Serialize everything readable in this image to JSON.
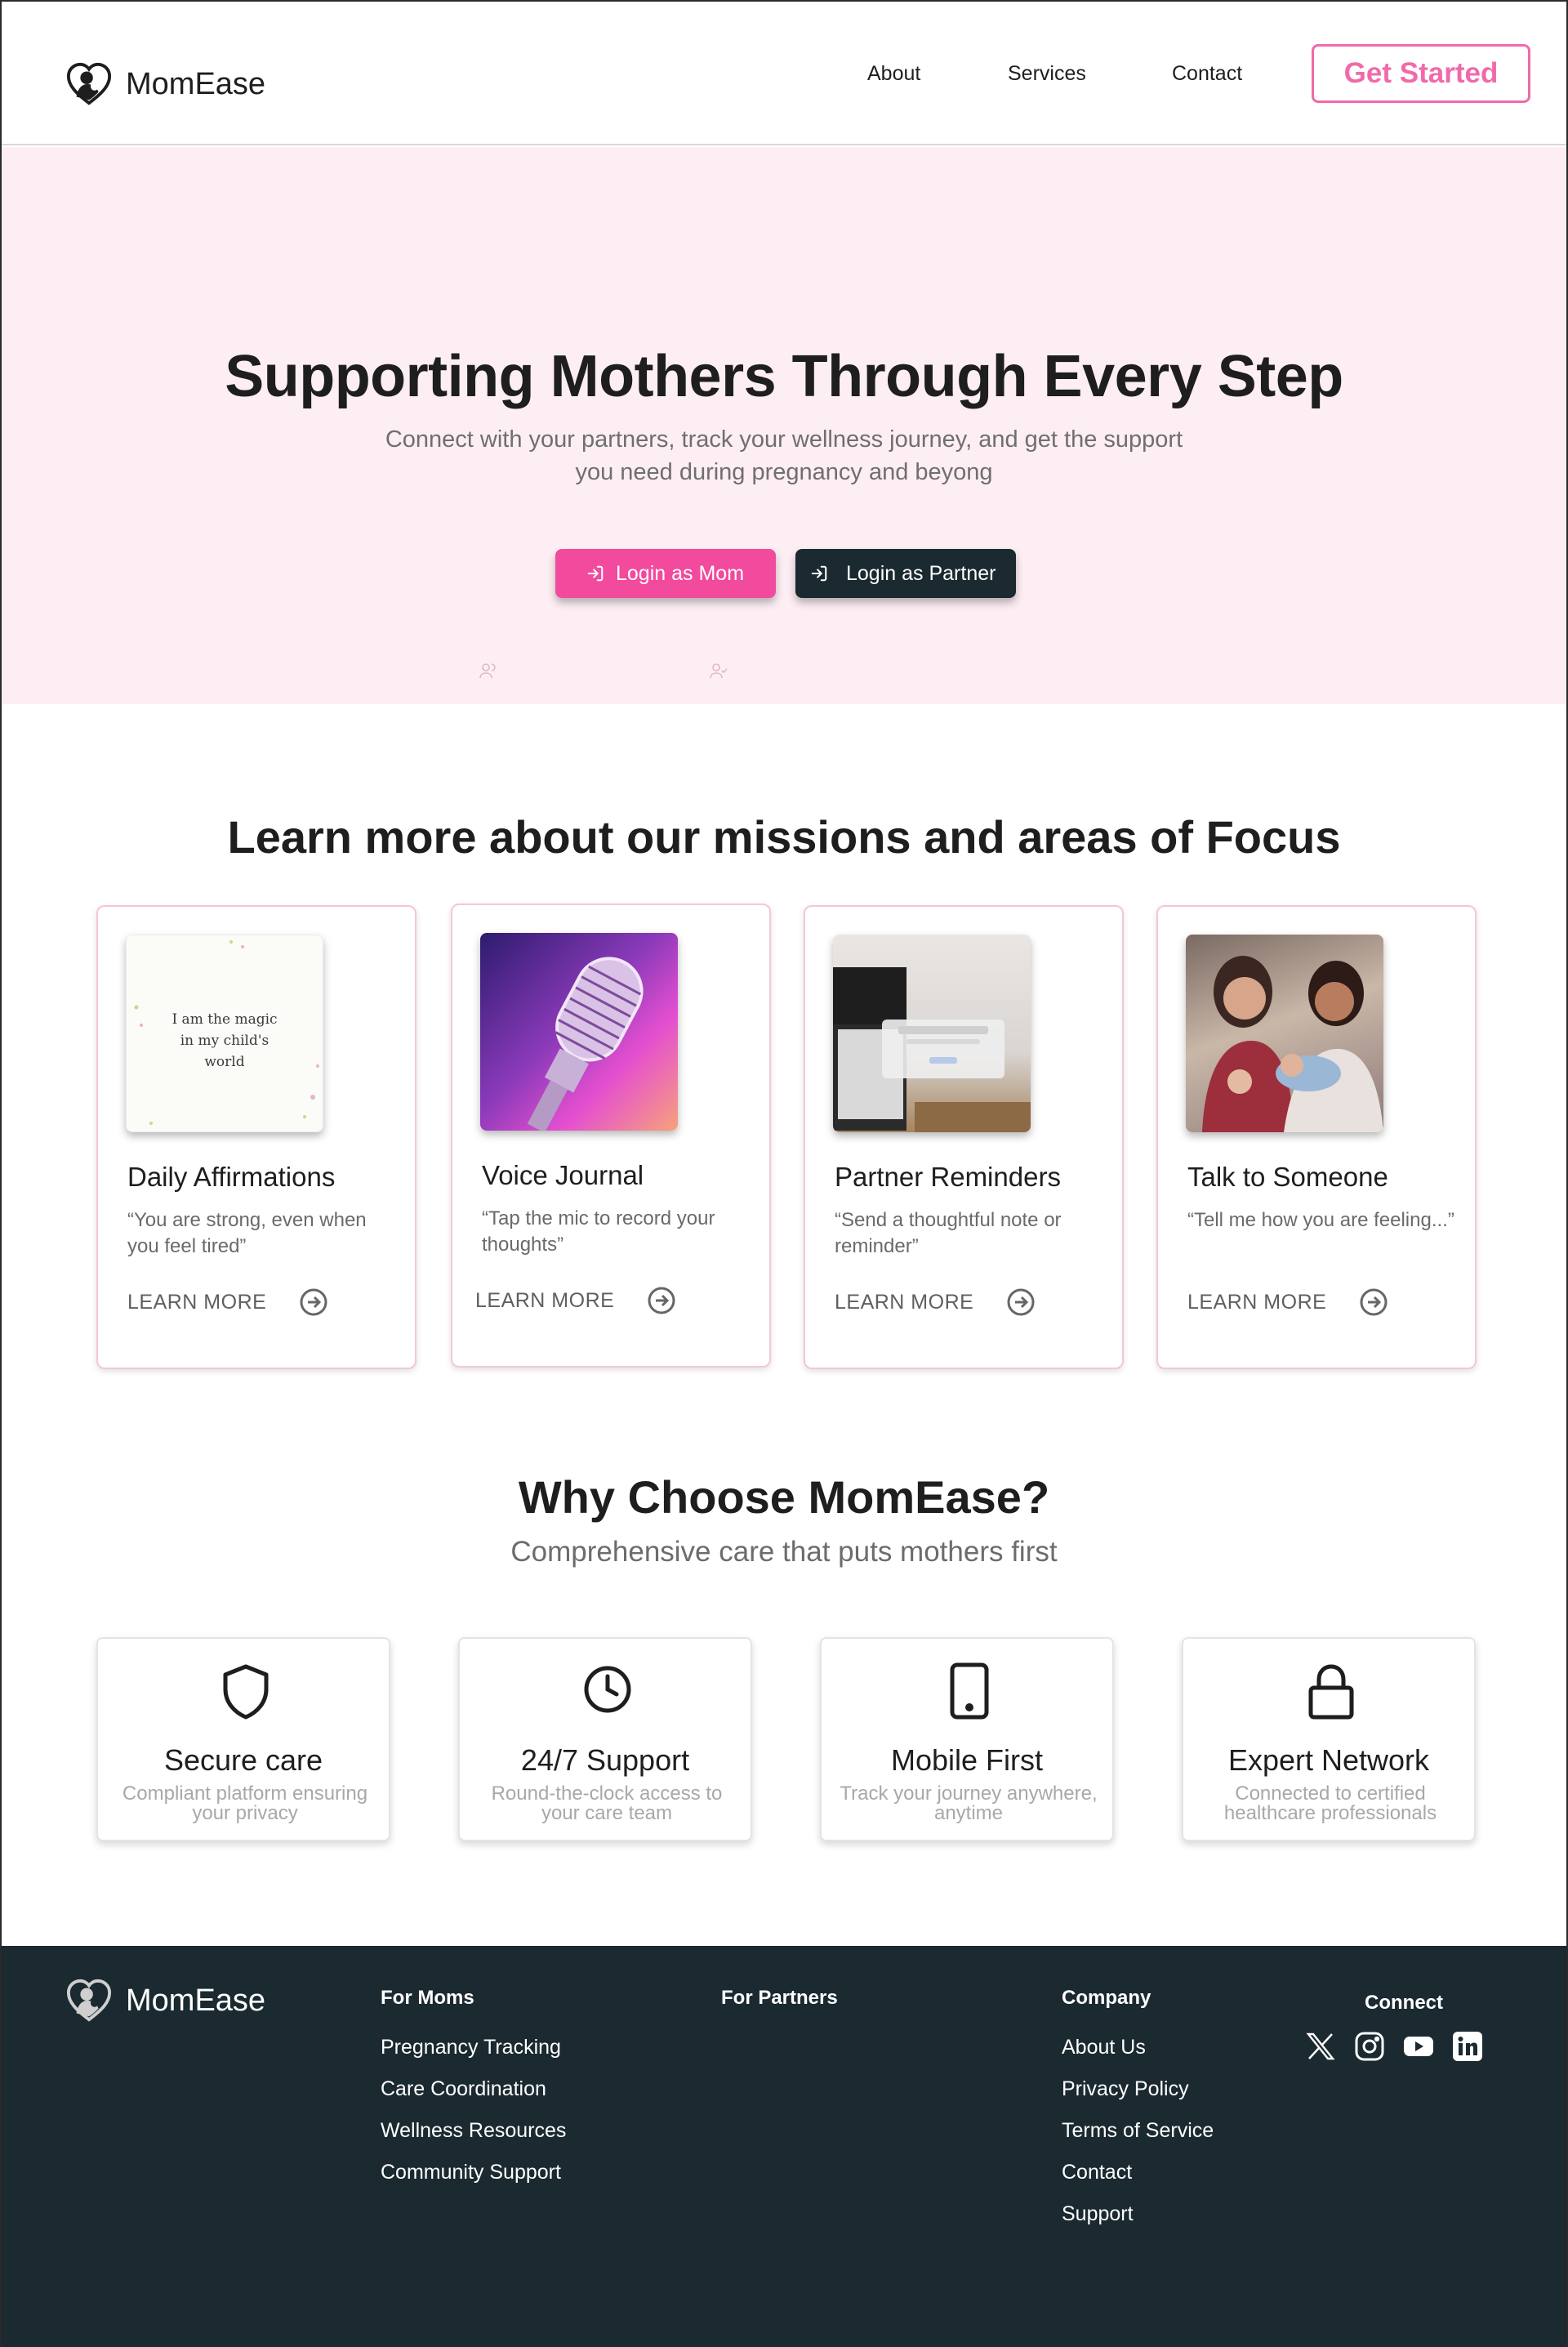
{
  "nav": {
    "brand": "MomEase",
    "links": [
      "About",
      "Services",
      "Contact"
    ],
    "cta": "Get Started"
  },
  "hero": {
    "title": "Supporting Mothers Through Every Step",
    "subtitle": "Connect with your partners, track your wellness journey, and get the support you need during pregnancy and beyong",
    "login_mom": "Login as Mom",
    "login_partner": "Login as Partner"
  },
  "missions": {
    "title": "Learn more about our missions and areas of Focus",
    "cards": [
      {
        "title": "Daily Affirmations",
        "quote": "“You are strong, even when you feel tired”",
        "learn": "LEARN MORE",
        "image_text": "I am the magic in my child's world"
      },
      {
        "title": "Voice Journal",
        "quote": "“Tap the mic to record your thoughts”",
        "learn": "LEARN MORE"
      },
      {
        "title": "Partner Reminders",
        "quote": "“Send a thoughtful note or reminder”",
        "learn": "LEARN MORE"
      },
      {
        "title": "Talk to Someone",
        "quote": "“Tell me how you are feeling...”",
        "learn": "LEARN MORE"
      }
    ]
  },
  "why": {
    "title": "Why Choose MomEase?",
    "subtitle": "Comprehensive care that puts mothers first",
    "features": [
      {
        "title": "Secure care",
        "desc": "Compliant platform ensuring your privacy",
        "icon": "shield-icon"
      },
      {
        "title": "24/7 Support",
        "desc": "Round-the-clock access to your care team",
        "icon": "clock-icon"
      },
      {
        "title": "Mobile First",
        "desc": "Track your journey anywhere, anytime",
        "icon": "phone-icon"
      },
      {
        "title": "Expert Network",
        "desc": "Connected to certified healthcare professionals",
        "icon": "lock-icon"
      }
    ]
  },
  "footer": {
    "brand": "MomEase",
    "for_moms": {
      "heading": "For Moms",
      "links": [
        "Pregnancy Tracking",
        "Care Coordination",
        "Wellness Resources",
        "Community Support"
      ]
    },
    "for_partners": {
      "heading": "For Partners"
    },
    "company": {
      "heading": "Company",
      "links": [
        "About Us",
        "Privacy Policy",
        "Terms of Service",
        "Contact",
        "Support"
      ]
    },
    "connect": {
      "heading": "Connect",
      "icons": [
        "x-icon",
        "instagram-icon",
        "youtube-icon",
        "linkedin-icon"
      ]
    }
  },
  "colors": {
    "accent_pink": "#f24a9d",
    "cta_pink": "#f06aaa",
    "hero_bg": "#fdeef4",
    "dark": "#1b2930"
  }
}
